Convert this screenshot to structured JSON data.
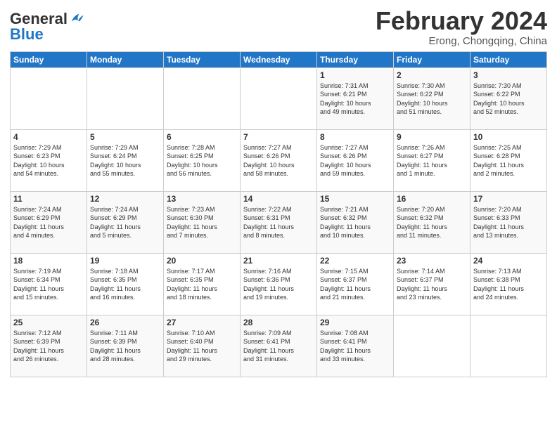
{
  "header": {
    "logo_general": "General",
    "logo_blue": "Blue",
    "month_title": "February 2024",
    "location": "Erong, Chongqing, China"
  },
  "weekdays": [
    "Sunday",
    "Monday",
    "Tuesday",
    "Wednesday",
    "Thursday",
    "Friday",
    "Saturday"
  ],
  "weeks": [
    [
      {
        "day": "",
        "info": ""
      },
      {
        "day": "",
        "info": ""
      },
      {
        "day": "",
        "info": ""
      },
      {
        "day": "",
        "info": ""
      },
      {
        "day": "1",
        "info": "Sunrise: 7:31 AM\nSunset: 6:21 PM\nDaylight: 10 hours\nand 49 minutes."
      },
      {
        "day": "2",
        "info": "Sunrise: 7:30 AM\nSunset: 6:22 PM\nDaylight: 10 hours\nand 51 minutes."
      },
      {
        "day": "3",
        "info": "Sunrise: 7:30 AM\nSunset: 6:22 PM\nDaylight: 10 hours\nand 52 minutes."
      }
    ],
    [
      {
        "day": "4",
        "info": "Sunrise: 7:29 AM\nSunset: 6:23 PM\nDaylight: 10 hours\nand 54 minutes."
      },
      {
        "day": "5",
        "info": "Sunrise: 7:29 AM\nSunset: 6:24 PM\nDaylight: 10 hours\nand 55 minutes."
      },
      {
        "day": "6",
        "info": "Sunrise: 7:28 AM\nSunset: 6:25 PM\nDaylight: 10 hours\nand 56 minutes."
      },
      {
        "day": "7",
        "info": "Sunrise: 7:27 AM\nSunset: 6:26 PM\nDaylight: 10 hours\nand 58 minutes."
      },
      {
        "day": "8",
        "info": "Sunrise: 7:27 AM\nSunset: 6:26 PM\nDaylight: 10 hours\nand 59 minutes."
      },
      {
        "day": "9",
        "info": "Sunrise: 7:26 AM\nSunset: 6:27 PM\nDaylight: 11 hours\nand 1 minute."
      },
      {
        "day": "10",
        "info": "Sunrise: 7:25 AM\nSunset: 6:28 PM\nDaylight: 11 hours\nand 2 minutes."
      }
    ],
    [
      {
        "day": "11",
        "info": "Sunrise: 7:24 AM\nSunset: 6:29 PM\nDaylight: 11 hours\nand 4 minutes."
      },
      {
        "day": "12",
        "info": "Sunrise: 7:24 AM\nSunset: 6:29 PM\nDaylight: 11 hours\nand 5 minutes."
      },
      {
        "day": "13",
        "info": "Sunrise: 7:23 AM\nSunset: 6:30 PM\nDaylight: 11 hours\nand 7 minutes."
      },
      {
        "day": "14",
        "info": "Sunrise: 7:22 AM\nSunset: 6:31 PM\nDaylight: 11 hours\nand 8 minutes."
      },
      {
        "day": "15",
        "info": "Sunrise: 7:21 AM\nSunset: 6:32 PM\nDaylight: 11 hours\nand 10 minutes."
      },
      {
        "day": "16",
        "info": "Sunrise: 7:20 AM\nSunset: 6:32 PM\nDaylight: 11 hours\nand 11 minutes."
      },
      {
        "day": "17",
        "info": "Sunrise: 7:20 AM\nSunset: 6:33 PM\nDaylight: 11 hours\nand 13 minutes."
      }
    ],
    [
      {
        "day": "18",
        "info": "Sunrise: 7:19 AM\nSunset: 6:34 PM\nDaylight: 11 hours\nand 15 minutes."
      },
      {
        "day": "19",
        "info": "Sunrise: 7:18 AM\nSunset: 6:35 PM\nDaylight: 11 hours\nand 16 minutes."
      },
      {
        "day": "20",
        "info": "Sunrise: 7:17 AM\nSunset: 6:35 PM\nDaylight: 11 hours\nand 18 minutes."
      },
      {
        "day": "21",
        "info": "Sunrise: 7:16 AM\nSunset: 6:36 PM\nDaylight: 11 hours\nand 19 minutes."
      },
      {
        "day": "22",
        "info": "Sunrise: 7:15 AM\nSunset: 6:37 PM\nDaylight: 11 hours\nand 21 minutes."
      },
      {
        "day": "23",
        "info": "Sunrise: 7:14 AM\nSunset: 6:37 PM\nDaylight: 11 hours\nand 23 minutes."
      },
      {
        "day": "24",
        "info": "Sunrise: 7:13 AM\nSunset: 6:38 PM\nDaylight: 11 hours\nand 24 minutes."
      }
    ],
    [
      {
        "day": "25",
        "info": "Sunrise: 7:12 AM\nSunset: 6:39 PM\nDaylight: 11 hours\nand 26 minutes."
      },
      {
        "day": "26",
        "info": "Sunrise: 7:11 AM\nSunset: 6:39 PM\nDaylight: 11 hours\nand 28 minutes."
      },
      {
        "day": "27",
        "info": "Sunrise: 7:10 AM\nSunset: 6:40 PM\nDaylight: 11 hours\nand 29 minutes."
      },
      {
        "day": "28",
        "info": "Sunrise: 7:09 AM\nSunset: 6:41 PM\nDaylight: 11 hours\nand 31 minutes."
      },
      {
        "day": "29",
        "info": "Sunrise: 7:08 AM\nSunset: 6:41 PM\nDaylight: 11 hours\nand 33 minutes."
      },
      {
        "day": "",
        "info": ""
      },
      {
        "day": "",
        "info": ""
      }
    ]
  ]
}
